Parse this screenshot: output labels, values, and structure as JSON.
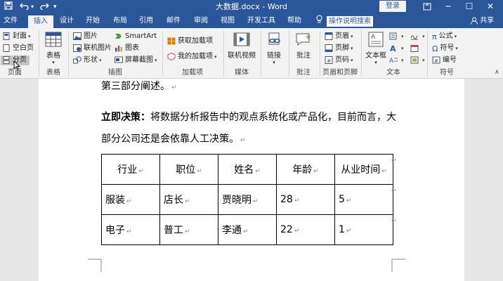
{
  "titlebar": {
    "doc_title": "大数据.docx - Word",
    "login_label": "登录",
    "minimize": "─",
    "restore": "❐",
    "maximize": "☐",
    "close": "✕"
  },
  "tabs": [
    {
      "label": "文件"
    },
    {
      "label": "插入"
    },
    {
      "label": "设计"
    },
    {
      "label": "开始"
    },
    {
      "label": "布局"
    },
    {
      "label": "引用"
    },
    {
      "label": "邮件"
    },
    {
      "label": "审阅"
    },
    {
      "label": "视图"
    },
    {
      "label": "开发工具"
    },
    {
      "label": "帮助"
    }
  ],
  "tell_me": "操作说明搜索",
  "share_label": "共享",
  "ribbon": {
    "pages": {
      "cover": "封面",
      "blank": "空白页",
      "break": "分页",
      "group": "页面"
    },
    "table": {
      "label": "表格",
      "group": "表格"
    },
    "illustrations": {
      "pictures": "图片",
      "online_pictures": "联机图片",
      "shapes": "形状",
      "smartart": "SmartArt",
      "chart": "图表",
      "screenshot": "屏幕截图",
      "group": "插图"
    },
    "addins": {
      "get": "获取加载项",
      "my": "我的加载项",
      "group": "加载项"
    },
    "media": {
      "video": "联机视频",
      "group": "媒体"
    },
    "links": {
      "link": "链接"
    },
    "comments": {
      "comment": "批注",
      "group": "批注"
    },
    "header_footer": {
      "header": "页眉",
      "footer": "页脚",
      "page_number": "页码",
      "group": "页眉和页脚"
    },
    "text": {
      "textbox": "文本框",
      "group": "文本"
    },
    "symbols": {
      "equation": "公式",
      "symbol": "符号",
      "number": "编号",
      "group": "符号"
    }
  },
  "document": {
    "line1": "第三部分阐述。",
    "decision_bold": "立即决策：",
    "decision_text": "将数据分析报告中的观点系统化或产品化，目前而言，大",
    "line3": "部分公司还是会依靠人工决策。",
    "para_mark": "↵",
    "table": {
      "header": [
        "行业",
        "职位",
        "姓名",
        "年龄",
        "从业时间"
      ],
      "rows": [
        [
          "服装",
          "店长",
          "贾晓明",
          "28",
          "5"
        ],
        [
          "电子",
          "普工",
          "李通",
          "22",
          "1"
        ]
      ]
    }
  },
  "colors": {
    "brand": "#2b579a",
    "ribbon_bg": "#f3f3f3",
    "doc_bg": "#e6e6e6"
  }
}
